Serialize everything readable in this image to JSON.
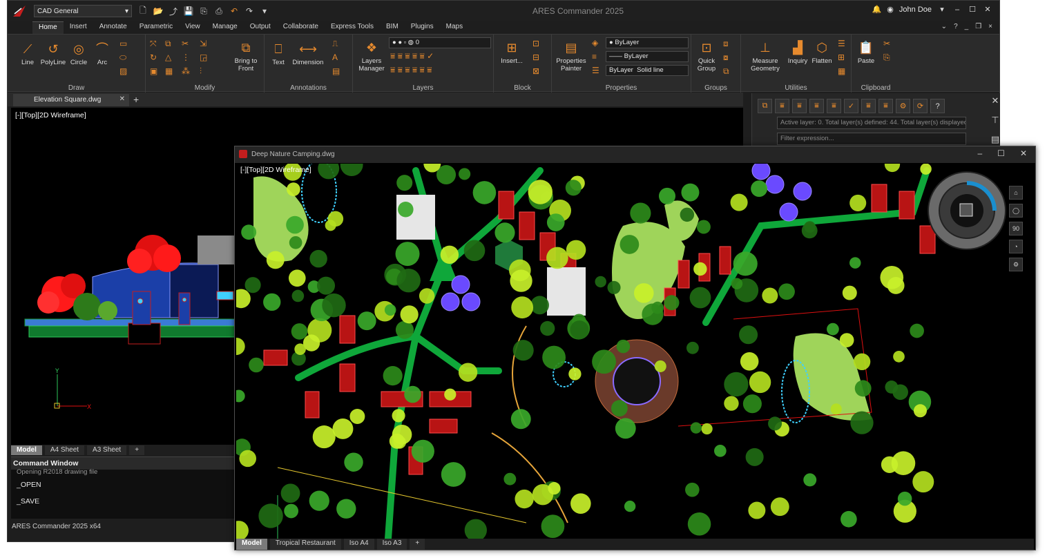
{
  "app": {
    "title": "ARES Commander 2025",
    "workspace": "CAD General",
    "user": "John Doe",
    "status_text": "ARES Commander 2025 x64"
  },
  "ribbon_tabs": [
    "Home",
    "Insert",
    "Annotate",
    "Parametric",
    "View",
    "Manage",
    "Output",
    "Collaborate",
    "Express Tools",
    "BIM",
    "Plugins",
    "Maps"
  ],
  "ribbon_right": [
    "?",
    "-",
    "_",
    "❒",
    "×"
  ],
  "panels": {
    "draw": {
      "title": "Draw",
      "tools": [
        "Line",
        "PolyLine",
        "Circle",
        "Arc"
      ]
    },
    "modify": {
      "title": "Modify",
      "bring_to_front": "Bring to\nFront"
    },
    "annotations": {
      "title": "Annotations",
      "tools": [
        "Text",
        "Dimension"
      ]
    },
    "layers": {
      "title": "Layers",
      "layers_manager": "Layers\nManager",
      "current_layer": "0"
    },
    "block": {
      "title": "Block",
      "insert": "Insert..."
    },
    "properties": {
      "title": "Properties",
      "painter": "Properties\nPainter",
      "color": "ByLayer",
      "linetype": "ByLayer",
      "lineweight_label": "ByLayer",
      "lineweight": "Solid line"
    },
    "groups": {
      "title": "Groups",
      "quick_group": "Quick\nGroup"
    },
    "utilities": {
      "title": "Utilities",
      "tools": [
        "Measure\nGeometry",
        "Inquiry",
        "Flatten"
      ]
    },
    "clipboard": {
      "title": "Clipboard",
      "paste": "Paste"
    }
  },
  "doc_tab": {
    "name": "Elevation Square.dwg"
  },
  "viewport1": {
    "label": "[-][Top][2D Wireframe]"
  },
  "layout_tabs_1": [
    "Model",
    "A4 Sheet",
    "A3 Sheet"
  ],
  "command_window": {
    "title": "Command Window",
    "lines": [
      "Opening R2018 drawing file",
      "_OPEN",
      "_SAVE"
    ]
  },
  "layers_palette": {
    "info": "Active layer: 0. Total layer(s) defined: 44. Total layer(s) displayed",
    "filter_placeholder": "Filter expression..."
  },
  "window2": {
    "title": "Deep Nature Camping.dwg",
    "label": "[-][Top][2D Wireframe]",
    "layout_tabs": [
      "Model",
      "Tropical Restaurant",
      "Iso A4",
      "Iso A3"
    ],
    "nav_zoom": "90"
  },
  "colors": {
    "accent": "#e68a2e",
    "brand": "#c41e1e",
    "bg": "#1e1e1e"
  }
}
